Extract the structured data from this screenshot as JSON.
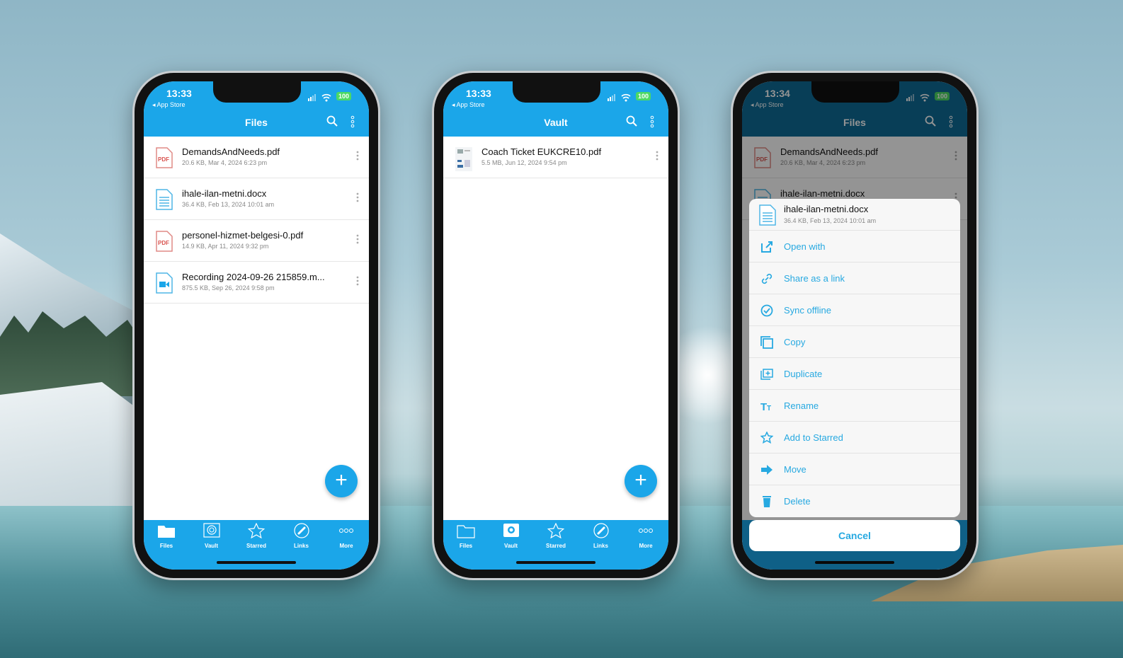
{
  "colors": {
    "accent": "#1ba6e9",
    "menu_text": "#27a9e1",
    "pdf_red": "#d9534f"
  },
  "phones": [
    {
      "status": {
        "time": "13:33",
        "back": "◂ App Store",
        "battery": "100"
      },
      "header": {
        "title": "Files"
      },
      "files": [
        {
          "name": "DemandsAndNeeds.pdf",
          "meta": "20.6 KB, Mar 4, 2024 6:23 pm",
          "icon": "pdf-icon"
        },
        {
          "name": "ihale-ilan-metni.docx",
          "meta": "36.4 KB, Feb 13, 2024 10:01 am",
          "icon": "doc-icon"
        },
        {
          "name": "personel-hizmet-belgesi-0.pdf",
          "meta": "14.9 KB, Apr 11, 2024 9:32 pm",
          "icon": "pdf-icon"
        },
        {
          "name": "Recording 2024-09-26 215859.m...",
          "meta": "875.5 KB, Sep 26, 2024 9:58 pm",
          "icon": "video-icon"
        }
      ],
      "active_tab": 0
    },
    {
      "status": {
        "time": "13:33",
        "back": "◂ App Store",
        "battery": "100"
      },
      "header": {
        "title": "Vault"
      },
      "files": [
        {
          "name": "Coach Ticket EUKCRE10.pdf",
          "meta": "5.5 MB, Jun 12, 2024 9:54 pm",
          "icon": "thumbnail-icon"
        }
      ],
      "active_tab": 1
    },
    {
      "status": {
        "time": "13:34",
        "back": "◂ App Store",
        "battery": "100"
      },
      "header": {
        "title": "Files"
      },
      "files": [
        {
          "name": "DemandsAndNeeds.pdf",
          "meta": "20.6 KB, Mar 4, 2024 6:23 pm",
          "icon": "pdf-icon"
        },
        {
          "name": "ihale-ilan-metni.docx",
          "meta": "36.4 KB, Feb 13, 2024 10:01 am",
          "icon": "doc-icon"
        }
      ],
      "active_tab": 0,
      "sheet": {
        "file": {
          "name": "ihale-ilan-metni.docx",
          "meta": "36.4 KB, Feb 13, 2024 10:01 am"
        },
        "items": [
          {
            "label": "Open with",
            "icon": "open-external-icon"
          },
          {
            "label": "Share as a link",
            "icon": "link-icon"
          },
          {
            "label": "Sync offline",
            "icon": "check-circle-icon"
          },
          {
            "label": "Copy",
            "icon": "copy-icon"
          },
          {
            "label": "Duplicate",
            "icon": "duplicate-icon"
          },
          {
            "label": "Rename",
            "icon": "text-size-icon"
          },
          {
            "label": "Add to Starred",
            "icon": "star-icon"
          },
          {
            "label": "Move",
            "icon": "arrow-right-icon"
          },
          {
            "label": "Delete",
            "icon": "trash-icon"
          }
        ],
        "cancel": "Cancel"
      }
    }
  ],
  "tabs": [
    {
      "label": "Files",
      "icon": "folder-icon"
    },
    {
      "label": "Vault",
      "icon": "vault-icon"
    },
    {
      "label": "Starred",
      "icon": "star-icon"
    },
    {
      "label": "Links",
      "icon": "link-icon"
    },
    {
      "label": "More",
      "icon": "more-icon"
    }
  ]
}
